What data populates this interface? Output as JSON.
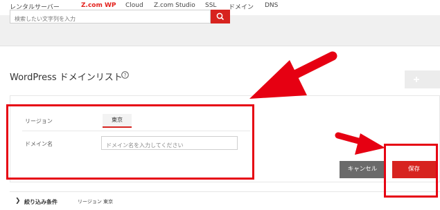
{
  "colors": {
    "accent_red": "#d7231f",
    "annotation_red": "#e60012",
    "cancel_gray": "#6a6a6a"
  },
  "nav": {
    "items": [
      {
        "label": "レンタルサーバー",
        "active": false
      },
      {
        "label": "Z.com WP",
        "active": true
      },
      {
        "label": "Cloud",
        "active": false
      },
      {
        "label": "Z.com Studio",
        "active": false
      },
      {
        "label": "SSL",
        "active": false
      },
      {
        "label": "ドメイン",
        "active": false
      },
      {
        "label": "DNS",
        "active": false
      }
    ]
  },
  "search": {
    "placeholder": "検索したい文字列を入力",
    "button_icon": "search-icon"
  },
  "page": {
    "title": "WordPress ドメインリスト",
    "help_icon": "question-circle-icon"
  },
  "toolbar": {
    "add_icon": "plus-icon"
  },
  "form": {
    "region_label": "リージョン",
    "region_value": "東京",
    "domain_label": "ドメイン名",
    "domain_placeholder": "ドメイン名を入力してください"
  },
  "actions": {
    "cancel_label": "キャンセル",
    "save_label": "保存"
  },
  "filter": {
    "chevron": "❯",
    "label": "絞り込み条件",
    "key": "リージョン",
    "value": "東京"
  }
}
